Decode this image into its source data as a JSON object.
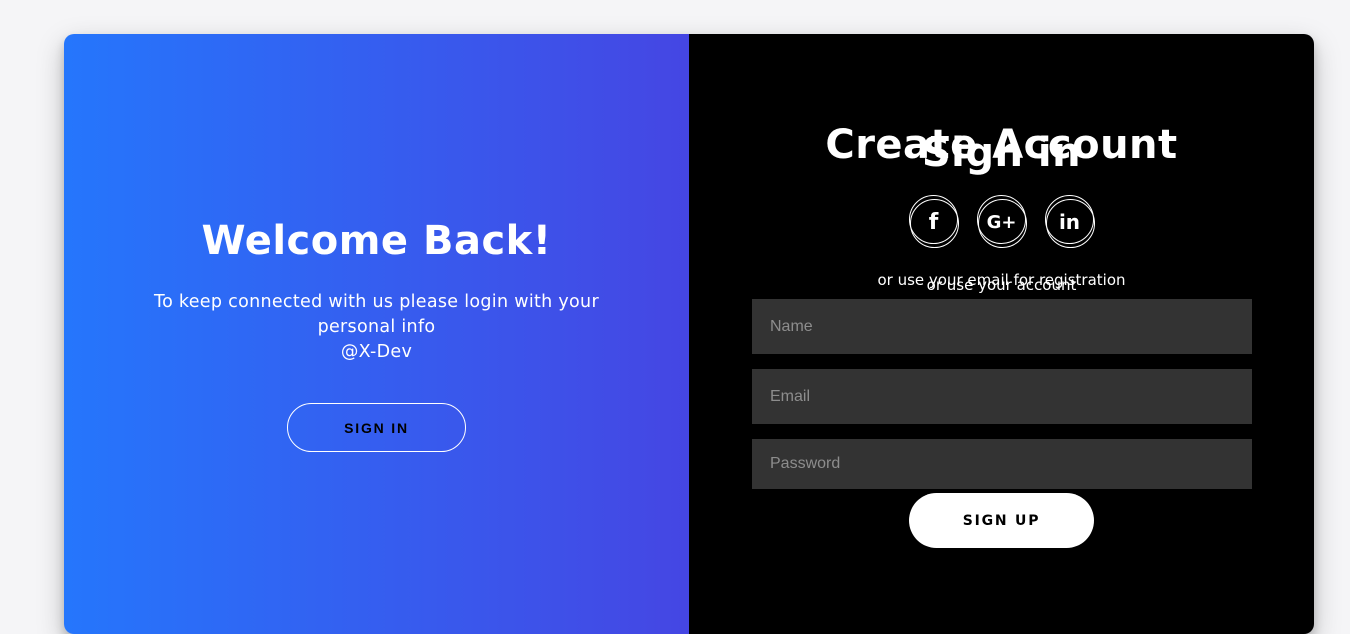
{
  "overlay_panel": {
    "title": "Welcome Back!",
    "message_line1": "To keep connected with us please login with your personal info",
    "message_line2": "@X-Dev",
    "button_label": "SIGN IN"
  },
  "form_panel": {
    "title_signup": "Create Account",
    "title_signin": "Sign in",
    "social": [
      {
        "icon": "facebook-icon",
        "glyph": "f"
      },
      {
        "icon": "google-plus-icon",
        "glyph": "G+"
      },
      {
        "icon": "linkedin-icon",
        "glyph": "in"
      }
    ],
    "subtitle_signup": "or use your email for registration",
    "subtitle_signin": "or use your account",
    "fields": {
      "name_placeholder": "Name",
      "email_placeholder": "Email",
      "password_placeholder": "Password"
    },
    "button_label": "SIGN UP"
  },
  "colors": {
    "gradient_start": "#2576fc",
    "gradient_end": "#4546e3",
    "form_background": "#000000",
    "field_background": "#333333"
  }
}
